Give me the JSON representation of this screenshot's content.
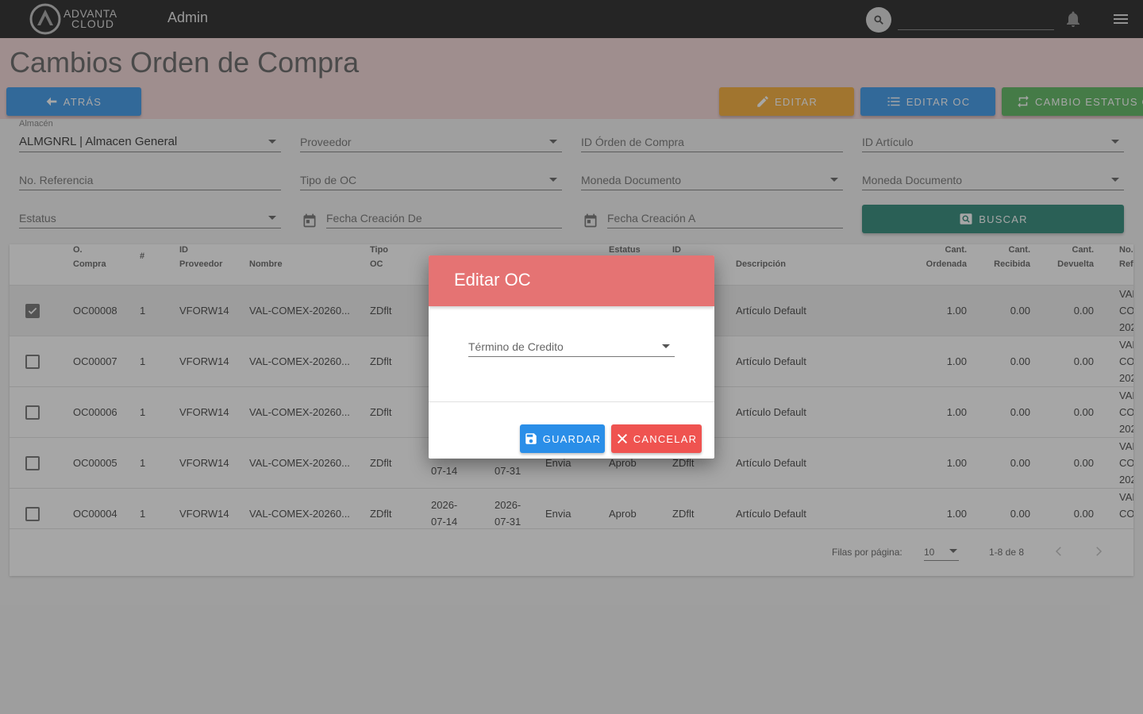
{
  "topbar": {
    "logo_line1": "ADVANTA",
    "logo_line2": "CLOUD",
    "app_title": "Admin",
    "search_value": ""
  },
  "page": {
    "title": "Cambios Orden de Compra",
    "buttons": {
      "back": "ATRÁS",
      "edit": "EDITAR",
      "edit_oc": "EDITAR OC",
      "change_status": "CAMBIO ESTATUS OC",
      "search": "BUSCAR"
    }
  },
  "filters": {
    "almacen_label": "Almacén",
    "almacen_value": "ALMGNRL | Almacen General",
    "proveedor": "Proveedor",
    "id_orden": "ID Órden de Compra",
    "id_articulo": "ID Artículo",
    "no_referencia": "No. Referencia",
    "tipo_oc": "Tipo de OC",
    "moneda_doc_1": "Moneda Documento",
    "moneda_doc_2": "Moneda Documento",
    "estatus": "Estatus",
    "fecha_de": "Fecha Creación De",
    "fecha_a": "Fecha Creación A"
  },
  "table": {
    "headers": {
      "ocompra_1": "O.",
      "ocompra_2": "Compra",
      "num": "#",
      "idprov_1": "ID",
      "idprov_2": "Proveedor",
      "nombre": "Nombre",
      "tipo_1": "Tipo",
      "tipo_2": "OC",
      "estatus": "Estatus",
      "id": "ID",
      "descripcion": "Descripción",
      "ordenada_1": "Cant.",
      "ordenada_2": "Ordenada",
      "recibida_1": "Cant.",
      "recibida_2": "Recibida",
      "devuelta_1": "Cant.",
      "devuelta_2": "Devuelta",
      "noref_1": "No.",
      "noref_2": "Ref"
    },
    "rows": [
      {
        "oc": "OC00008",
        "num": "1",
        "prov": "VFORW14",
        "nombre": "VAL-COMEX-20260...",
        "tipo": "ZDflt",
        "desc": "Artículo Default",
        "ord": "1.00",
        "rec": "0.00",
        "dev": "0.00",
        "ref1": "VAL",
        "ref2": "CO",
        "ref3": "202",
        "checked": true
      },
      {
        "oc": "OC00007",
        "num": "1",
        "prov": "VFORW14",
        "nombre": "VAL-COMEX-20260...",
        "tipo": "ZDflt",
        "desc": "Artículo Default",
        "ord": "1.00",
        "rec": "0.00",
        "dev": "0.00",
        "ref1": "VAL",
        "ref2": "CO",
        "ref3": "202",
        "checked": false
      },
      {
        "oc": "OC00006",
        "num": "1",
        "prov": "VFORW14",
        "nombre": "VAL-COMEX-20260...",
        "tipo": "ZDflt",
        "desc": "Artículo Default",
        "ord": "1.00",
        "rec": "0.00",
        "dev": "0.00",
        "ref1": "VAL",
        "ref2": "CO",
        "ref3": "202",
        "checked": false
      },
      {
        "oc": "OC00005",
        "num": "1",
        "prov": "VFORW14",
        "nombre": "VAL-COMEX-20260...",
        "tipo": "ZDflt",
        "f1": "07-14",
        "f2": "07-31",
        "env": "Envia",
        "est": "Aprob",
        "idc": "ZDflt",
        "desc": "Artículo Default",
        "ord": "1.00",
        "rec": "0.00",
        "dev": "0.00",
        "ref1": "VAL",
        "ref2": "CO",
        "ref3": "202",
        "checked": false
      },
      {
        "oc": "OC00004",
        "num": "1",
        "prov": "VFORW14",
        "nombre": "VAL-COMEX-20260...",
        "tipo": "ZDflt",
        "f1a": "2026-",
        "f1b": "07-14",
        "f2a": "2026-",
        "f2b": "07-31",
        "env": "Envia",
        "est": "Aprob",
        "idc": "ZDflt",
        "desc": "Artículo Default",
        "ord": "1.00",
        "rec": "0.00",
        "dev": "0.00",
        "ref1": "VAL",
        "ref2": "CO",
        "checked": false
      }
    ],
    "footer": {
      "rows_per_page_label": "Filas por página:",
      "rows_per_page": "10",
      "range": "1-8 de 8"
    }
  },
  "dialog": {
    "title": "Editar OC",
    "field_label": "Término de Credito",
    "save": "GUARDAR",
    "cancel": "CANCELAR"
  }
}
